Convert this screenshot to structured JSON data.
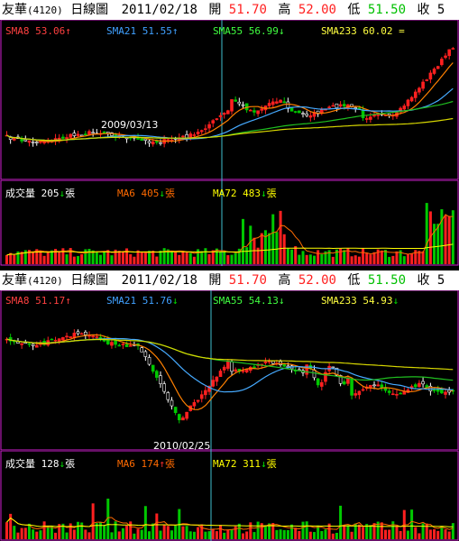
{
  "colors": {
    "up": "#ff2020",
    "down": "#00c800",
    "sma8": "#ff8000",
    "sma21": "#46aaff",
    "sma55": "#20c020",
    "sma233": "#d6d600",
    "cursor": "#40c0d0",
    "label_white": "#ffffff",
    "vol_label": "#ffffff",
    "ma6": "#ff6a00",
    "ma72": "#ffff00",
    "border": "#d020d0",
    "sma8_label": "#ff4040",
    "sma21_label": "#40a0ff",
    "sma55_label": "#40ff40",
    "sma233_label": "#ffff40"
  },
  "panels": [
    {
      "id": "top",
      "header": {
        "name": "友華",
        "code": "(4120)",
        "type": "日線圖",
        "date": "2011/02/18",
        "open_label": "開",
        "open": "51.70",
        "high_label": "高",
        "high": "52.00",
        "low_label": "低",
        "low": "51.50",
        "close_label": "收",
        "close": "5"
      },
      "ma_labels": {
        "sma8": "SMA8 53.06",
        "sma8_arrow": "↑",
        "sma21": "SMA21 51.55",
        "sma21_arrow": "↑",
        "sma55": "SMA55 56.99",
        "sma55_arrow": "↓",
        "sma233": "SMA233 60.02",
        "sma233_arrow": "="
      },
      "volume_labels": {
        "vol": "成交量 205",
        "vol_arrow": "↓",
        "vol_unit": "張",
        "ma6": "MA6 405",
        "ma6_arrow": "↓",
        "ma6_unit": "張",
        "ma72": "MA72 483",
        "ma72_arrow": "↓",
        "ma72_unit": "張"
      },
      "annotation": "2009/03/13"
    },
    {
      "id": "bottom",
      "header": {
        "name": "友華",
        "code": "(4120)",
        "type": "日線圖",
        "date": "2011/02/18",
        "open_label": "開",
        "open": "51.70",
        "high_label": "高",
        "high": "52.00",
        "low_label": "低",
        "low": "51.50",
        "close_label": "收",
        "close": "5"
      },
      "ma_labels": {
        "sma8": "SMA8 51.17",
        "sma8_arrow": "↑",
        "sma21": "SMA21 51.76",
        "sma21_arrow": "↓",
        "sma55": "SMA55 54.13",
        "sma55_arrow": "↓",
        "sma233": "SMA233 54.93",
        "sma233_arrow": "↓"
      },
      "volume_labels": {
        "vol": "成交量 128",
        "vol_arrow": "↓",
        "vol_unit": "張",
        "ma6": "MA6 174",
        "ma6_arrow": "↑",
        "ma6_unit": "張",
        "ma72": "MA72 311",
        "ma72_arrow": "↓",
        "ma72_unit": "張"
      },
      "annotation": "2010/02/25"
    }
  ],
  "chart_data": [
    {
      "type": "candlestick",
      "panel": "top",
      "description_series": [
        "SMA8",
        "SMA21",
        "SMA55",
        "SMA233"
      ],
      "ma_values_at_cursor": {
        "SMA8": 53.06,
        "SMA21": 51.55,
        "SMA55": 56.99,
        "SMA233": 60.02
      },
      "volume": {
        "last": 205,
        "MA6": 405,
        "MA72": 483
      },
      "annotation": "2009/03/13"
    },
    {
      "type": "candlestick",
      "panel": "bottom",
      "ma_values_at_cursor": {
        "SMA8": 51.17,
        "SMA21": 51.76,
        "SMA55": 54.13,
        "SMA233": 54.93
      },
      "volume": {
        "last": 128,
        "MA6": 174,
        "MA72": 311
      },
      "annotation": "2010/02/25"
    }
  ]
}
